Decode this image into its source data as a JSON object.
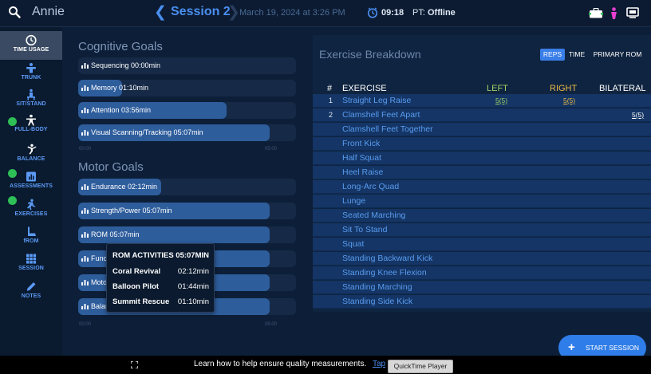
{
  "header": {
    "patient_name": "Annie",
    "session_title": "Session 2",
    "session_date": "March 19, 2024 at 3:26 PM",
    "timer": "09:18",
    "pt_prefix": "PT:",
    "pt_status": "Offline",
    "colors": {
      "accent": "#4a8ef0",
      "person_icon": "#e83fd2",
      "status_green": "#2ebf56"
    }
  },
  "sidebar": {
    "items": [
      {
        "label": "TIME USAGE",
        "icon": "clock-icon",
        "active": true
      },
      {
        "label": "TRUNK",
        "icon": "trunk-icon"
      },
      {
        "label": "SIT/STAND",
        "icon": "sit-stand-icon"
      },
      {
        "label": "FULL-BODY",
        "icon": "full-body-icon",
        "badge": true
      },
      {
        "label": "BALANCE",
        "icon": "balance-icon"
      },
      {
        "label": "ASSESSMENTS",
        "icon": "assessments-icon",
        "badge": true
      },
      {
        "label": "EXERCISES",
        "icon": "exercises-icon",
        "badge": true
      },
      {
        "label": "fROM",
        "icon": "from-icon"
      },
      {
        "label": "SESSION",
        "icon": "session-grid-icon"
      },
      {
        "label": "NOTES",
        "icon": "notes-pencil-icon"
      }
    ]
  },
  "cognitive": {
    "title": "Cognitive Goals",
    "goals": [
      {
        "label": "Sequencing 00:00min",
        "fill": 0.0
      },
      {
        "label": "Memory 01:10min",
        "fill": 0.2
      },
      {
        "label": "Attention 03:56min",
        "fill": 0.68
      },
      {
        "label": "Visual Scanning/Tracking 05:07min",
        "fill": 0.88
      }
    ],
    "scale_start": "00:00",
    "scale_end": "05:00"
  },
  "motor": {
    "title": "Motor Goals",
    "goals": [
      {
        "label": "Endurance 02:12min",
        "fill": 0.38
      },
      {
        "label": "Strength/Power 05:07min",
        "fill": 0.88
      },
      {
        "label": "ROM 05:07min",
        "fill": 0.88
      },
      {
        "label": "Funct",
        "fill": 0.88
      },
      {
        "label": "Motor",
        "fill": 0.88
      },
      {
        "label": "Balan",
        "fill": 0.88
      }
    ],
    "scale_start": "00:00",
    "scale_end": "05:00"
  },
  "popover": {
    "title": "ROM ACTIVITIES",
    "total": "05:07MIN",
    "rows": [
      {
        "name": "Coral Revival",
        "time": "02:12min"
      },
      {
        "name": "Balloon Pilot",
        "time": "01:44min"
      },
      {
        "name": "Summit Rescue",
        "time": "01:10min"
      }
    ]
  },
  "breakdown": {
    "title": "Exercise Breakdown",
    "toggles": [
      "REPS",
      "TIME",
      "PRIMARY ROM"
    ],
    "active_toggle": "REPS",
    "columns": {
      "num": "#",
      "exercise": "EXERCISE",
      "left": "LEFT",
      "right": "RIGHT",
      "bilateral": "BILATERAL"
    },
    "column_colors": {
      "left": "#9dd066",
      "right": "#e8b84a",
      "bilateral": "#ffffff"
    },
    "rows": [
      {
        "num": "1",
        "name": "Straight Leg Raise",
        "left": "5(5)",
        "right": "5(5)",
        "bilateral": ""
      },
      {
        "num": "2",
        "name": "Clamshell Feet Apart",
        "left": "",
        "right": "",
        "bilateral": "5(5)"
      },
      {
        "num": "",
        "name": "Clamshell Feet Together",
        "left": "",
        "right": "",
        "bilateral": ""
      },
      {
        "num": "",
        "name": "Front Kick",
        "left": "",
        "right": "",
        "bilateral": ""
      },
      {
        "num": "",
        "name": "Half Squat",
        "left": "",
        "right": "",
        "bilateral": ""
      },
      {
        "num": "",
        "name": "Heel Raise",
        "left": "",
        "right": "",
        "bilateral": ""
      },
      {
        "num": "",
        "name": "Long-Arc Quad",
        "left": "",
        "right": "",
        "bilateral": ""
      },
      {
        "num": "",
        "name": "Lunge",
        "left": "",
        "right": "",
        "bilateral": ""
      },
      {
        "num": "",
        "name": "Seated Marching",
        "left": "",
        "right": "",
        "bilateral": ""
      },
      {
        "num": "",
        "name": "Sit To Stand",
        "left": "",
        "right": "",
        "bilateral": ""
      },
      {
        "num": "",
        "name": "Squat",
        "left": "",
        "right": "",
        "bilateral": ""
      },
      {
        "num": "",
        "name": "Standing Backward Kick",
        "left": "",
        "right": "",
        "bilateral": ""
      },
      {
        "num": "",
        "name": "Standing Knee Flexion",
        "left": "",
        "right": "",
        "bilateral": ""
      },
      {
        "num": "",
        "name": "Standing Marching",
        "left": "",
        "right": "",
        "bilateral": ""
      },
      {
        "num": "",
        "name": "Standing Side Kick",
        "left": "",
        "right": "",
        "bilateral": ""
      }
    ]
  },
  "start_session": {
    "label": "START SESSION",
    "icon": "plus-icon"
  },
  "bottom_bar": {
    "help_text": "Learn how to help ensure quality measurements.",
    "help_link": "Tap",
    "tooltip": "QuickTime Player"
  }
}
